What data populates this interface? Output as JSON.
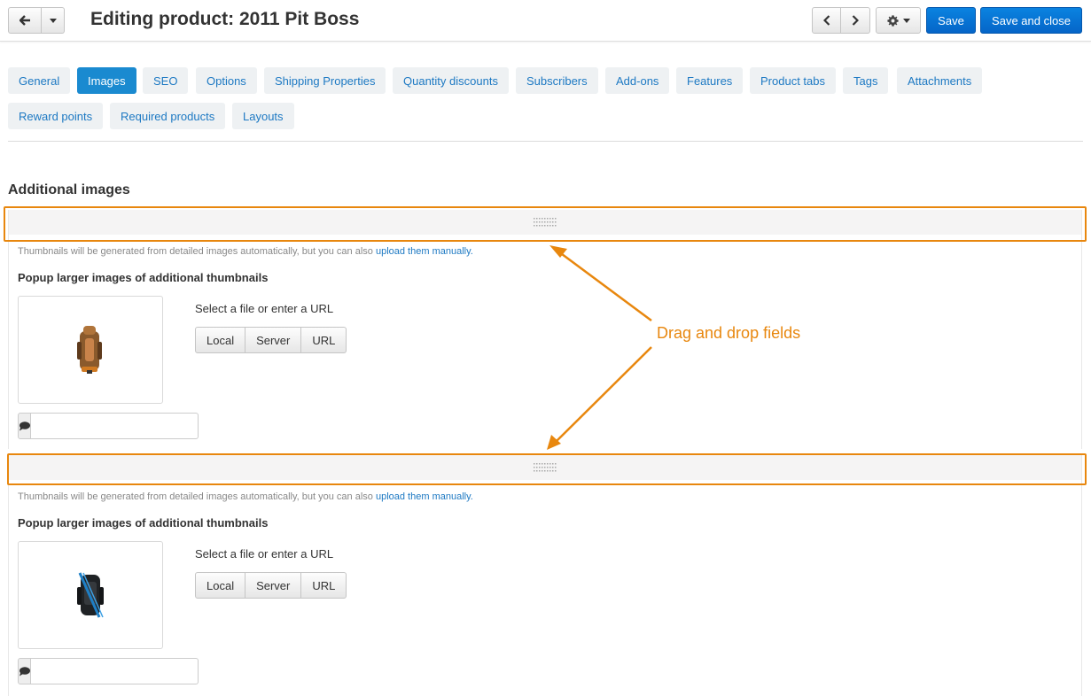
{
  "header": {
    "title": "Editing product: 2011 Pit Boss",
    "save_label": "Save",
    "save_close_label": "Save and close"
  },
  "tabs": [
    {
      "label": "General"
    },
    {
      "label": "Images"
    },
    {
      "label": "SEO"
    },
    {
      "label": "Options"
    },
    {
      "label": "Shipping Properties"
    },
    {
      "label": "Quantity discounts"
    },
    {
      "label": "Subscribers"
    },
    {
      "label": "Add-ons"
    },
    {
      "label": "Features"
    },
    {
      "label": "Product tabs"
    },
    {
      "label": "Tags"
    },
    {
      "label": "Attachments"
    },
    {
      "label": "Reward points"
    },
    {
      "label": "Required products"
    },
    {
      "label": "Layouts"
    }
  ],
  "active_tab": "Images",
  "section": {
    "title": "Additional images"
  },
  "image_blocks": [
    {
      "hint_text": "Thumbnails will be generated from detailed images automatically, but you can also",
      "hint_link": "upload them manually.",
      "popup_label": "Popup larger images of additional thumbnails",
      "select_text": "Select a file or enter a URL",
      "buttons": [
        "Local",
        "Server",
        "URL"
      ],
      "alt_value": ""
    },
    {
      "hint_text": "Thumbnails will be generated from detailed images automatically, but you can also",
      "hint_link": "upload them manually.",
      "popup_label": "Popup larger images of additional thumbnails",
      "select_text": "Select a file or enter a URL",
      "buttons": [
        "Local",
        "Server",
        "URL"
      ],
      "alt_value": ""
    }
  ],
  "annotation": {
    "label": "Drag and drop fields",
    "color": "#e8870e"
  },
  "colors": {
    "primary": "#0a79d8",
    "tab_text": "#1d79c3",
    "tab_active_bg": "#1a8ad0"
  },
  "icons": {
    "back": "arrow-left-icon",
    "dropdown": "caret-down-icon",
    "prev": "chevron-left-icon",
    "next": "chevron-right-icon",
    "settings": "gear-icon",
    "drag": "drag-handle-icon",
    "comment": "comment-icon"
  }
}
